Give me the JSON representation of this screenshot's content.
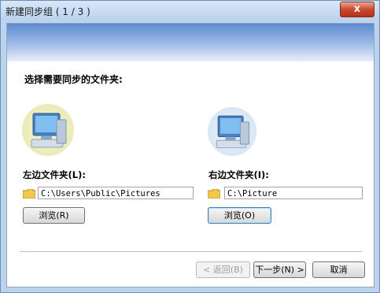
{
  "window": {
    "title": "新建同步组 ( 1 / 3 )",
    "close_label": "x"
  },
  "main": {
    "section_title": "选择需要同步的文件夹:"
  },
  "left": {
    "label": "左边文件夹(L):",
    "path": "C:\\Users\\Public\\Pictures",
    "browse_label": "浏览(R)"
  },
  "right": {
    "label": "右边文件夹(I):",
    "path": "C:\\Picture",
    "browse_label": "浏览(O)"
  },
  "footer": {
    "back_label": "< 返回(B)",
    "next_label": "下一步(N) >",
    "cancel_label": "取消"
  },
  "colors": {
    "banner_top": "#5d8bd0",
    "folder_yellow": "#f2c94c",
    "close_red": "#c9482f"
  }
}
